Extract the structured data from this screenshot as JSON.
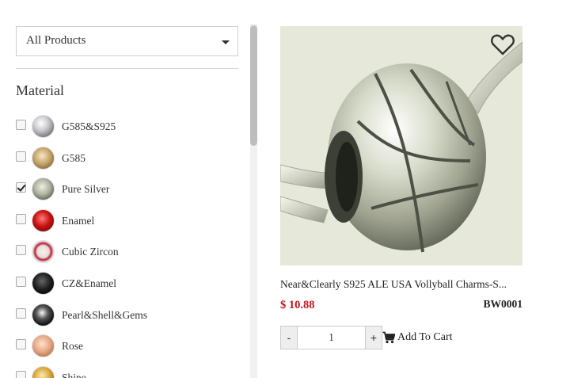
{
  "sidebar": {
    "category_select": {
      "value": "All Products"
    },
    "section_title": "Material",
    "filters": [
      {
        "label": "G585&S925",
        "checked": false,
        "thumb": "silver-bead"
      },
      {
        "label": "G585",
        "checked": false,
        "thumb": "gold-charm"
      },
      {
        "label": "Pure Silver",
        "checked": true,
        "thumb": "volleyball-bead"
      },
      {
        "label": "Enamel",
        "checked": false,
        "thumb": "red-heart"
      },
      {
        "label": "Cubic Zircon",
        "checked": false,
        "thumb": "pink-heart"
      },
      {
        "label": "CZ&Enamel",
        "checked": false,
        "thumb": "black-bead"
      },
      {
        "label": "Pearl&Shell&Gems",
        "checked": false,
        "thumb": "pearl-bead"
      },
      {
        "label": "Rose",
        "checked": false,
        "thumb": "rose-heart"
      },
      {
        "label": "Shine",
        "checked": false,
        "thumb": "shine-charm"
      }
    ]
  },
  "product": {
    "name": "Near&Clearly S925 ALE USA Vollyball Charms-S...",
    "price": "$ 10.88",
    "sku": "BW0001",
    "quantity": "1",
    "qty_minus": "-",
    "qty_plus": "+",
    "add_to_cart": "Add To Cart",
    "icons": {
      "wishlist": "heart-outline-icon",
      "cart": "shopping-cart-icon"
    },
    "colors": {
      "price": "#c0141c"
    }
  }
}
